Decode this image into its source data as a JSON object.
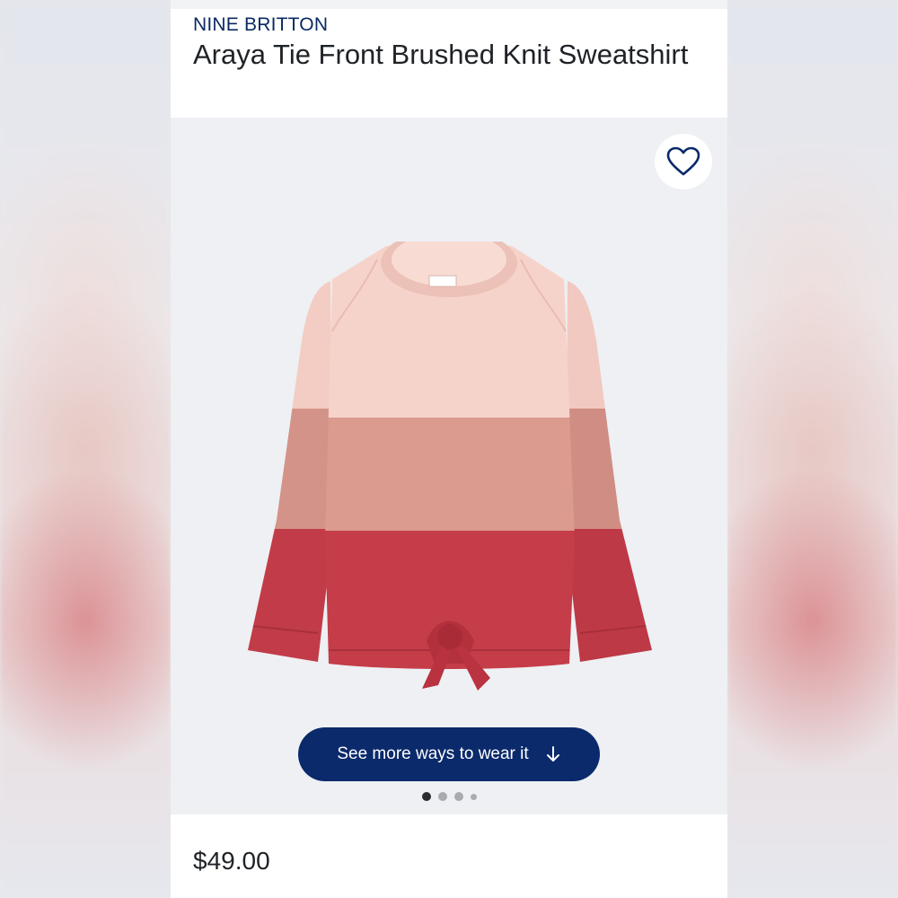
{
  "product": {
    "brand": "NINE BRITTON",
    "title": "Araya Tie Front Brushed Knit Sweatshirt",
    "price": "$49.00"
  },
  "gallery": {
    "favorite_icon": "heart-outline-icon",
    "cta_label": "See more ways to wear it",
    "cta_icon": "arrow-down-icon",
    "image_count": 4,
    "active_image": 1
  },
  "colors": {
    "accent_navy": "#0b2a6b",
    "brand_text": "#0b2a63",
    "band_light_pink": "#f4cdc4",
    "band_dusty_rose": "#d9978b",
    "band_red": "#c23b48"
  }
}
